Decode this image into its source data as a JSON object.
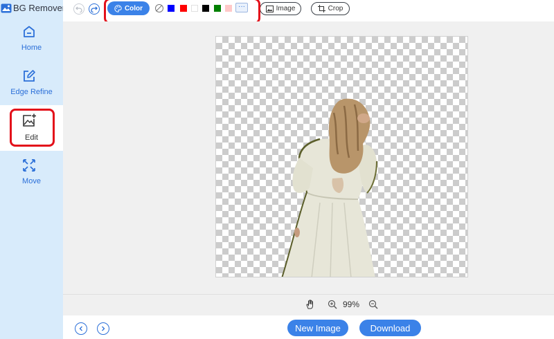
{
  "app": {
    "title": "BG Remover"
  },
  "sidebar": {
    "items": [
      {
        "label": "Home",
        "icon": "home-icon"
      },
      {
        "label": "Edge Refine",
        "icon": "edit-pencil-icon"
      },
      {
        "label": "Edit",
        "icon": "image-edit-icon",
        "active": true
      },
      {
        "label": "Move",
        "icon": "move-arrows-icon"
      }
    ]
  },
  "toolbar": {
    "color_label": "Color",
    "swatches": [
      "#0000ff",
      "#ff0000",
      "#ffffff",
      "#000000",
      "#008000",
      "#ffc8c8"
    ],
    "more_label": "···",
    "image_label": "Image",
    "crop_label": "Crop"
  },
  "zoom": {
    "value": "99%"
  },
  "actions": {
    "new_image_label": "New Image",
    "download_label": "Download"
  },
  "colors": {
    "accent": "#3b82e8",
    "sidebar_bg": "#d8ebfb",
    "highlight": "#e3101a"
  }
}
